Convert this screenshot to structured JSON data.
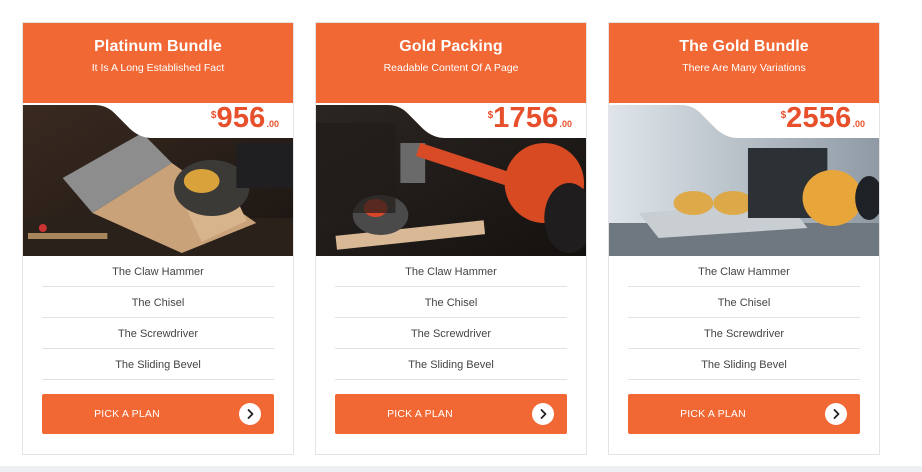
{
  "brand": {
    "accent": "#f26835",
    "price_color": "#e8502b"
  },
  "plans": [
    {
      "title": "Platinum Bundle",
      "subtitle": "It Is A Long Established Fact",
      "currency": "$",
      "amount": "956",
      "cents": ".00",
      "image": "hand-saw-cutting-wood",
      "features": [
        "The Claw Hammer",
        "The Chisel",
        "The Screwdriver",
        "The Sliding Bevel"
      ],
      "button_label": "PICK A PLAN",
      "button_icon": "chevron-right-icon"
    },
    {
      "title": "Gold Packing",
      "subtitle": "Readable Content Of A Page",
      "currency": "$",
      "amount": "1756",
      "cents": ".00",
      "image": "hammer-striking-nail",
      "features": [
        "The Claw Hammer",
        "The Chisel",
        "The Screwdriver",
        "The Sliding Bevel"
      ],
      "button_label": "PICK A PLAN",
      "button_icon": "chevron-right-icon"
    },
    {
      "title": "The Gold Bundle",
      "subtitle": "There Are Many Variations",
      "currency": "$",
      "amount": "2556",
      "cents": ".00",
      "image": "safety-glasses-and-ear-muffs",
      "features": [
        "The Claw Hammer",
        "The Chisel",
        "The Screwdriver",
        "The Sliding Bevel"
      ],
      "button_label": "PICK A PLAN",
      "button_icon": "chevron-right-icon"
    }
  ]
}
